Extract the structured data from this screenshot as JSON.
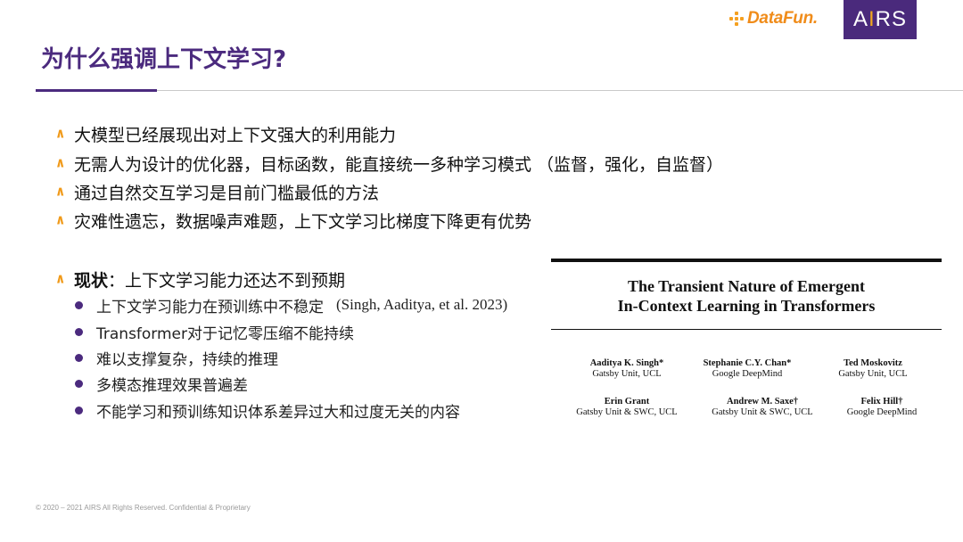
{
  "logos": {
    "datafun": "DataFun.",
    "airs_prefix": "A",
    "airs_i": "I",
    "airs_suffix": "RS"
  },
  "slide": {
    "title": "为什么强调上下文学习?"
  },
  "bullets": [
    "大模型已经展现出对上下文强大的利用能力",
    "无需人为设计的优化器，目标函数，能直接统一多种学习模式 （监督，强化，自监督）",
    "通过自然交互学习是目前门槛最低的方法",
    "灾难性遗忘，数据噪声难题，上下文学习比梯度下降更有优势"
  ],
  "status": {
    "label": "现状",
    "text": "：上下文学习能力还达不到预期",
    "items": [
      {
        "text": "上下文学习能力在预训练中不稳定",
        "cite": "(Singh, Aaditya, et al. 2023)"
      },
      {
        "text": "Transformer对于记忆零压缩不能持续",
        "cite": ""
      },
      {
        "text": "难以支撑复杂，持续的推理",
        "cite": ""
      },
      {
        "text": "多模态推理效果普遍差",
        "cite": ""
      },
      {
        "text": "不能学习和预训练知识体系差异过大和过度无关的内容",
        "cite": ""
      }
    ]
  },
  "paper": {
    "title_line1": "The Transient Nature of Emergent",
    "title_line2": "In-Context Learning in Transformers",
    "authors": [
      {
        "name": "Aaditya K. Singh*",
        "aff": "Gatsby Unit, UCL"
      },
      {
        "name": "Stephanie C.Y. Chan*",
        "aff": "Google DeepMind"
      },
      {
        "name": "Ted Moskovitz",
        "aff": "Gatsby Unit, UCL"
      },
      {
        "name": "Erin Grant",
        "aff": "Gatsby Unit & SWC, UCL"
      },
      {
        "name": "Andrew M. Saxe†",
        "aff": "Gatsby Unit & SWC, UCL"
      },
      {
        "name": "Felix Hill†",
        "aff": "Google DeepMind"
      }
    ]
  },
  "footer": "© 2020 – 2021 AIRS All Rights Reserved. Confidential & Proprietary",
  "colors": {
    "accent_purple": "#4b2a7e",
    "accent_orange": "#f09a1a"
  }
}
